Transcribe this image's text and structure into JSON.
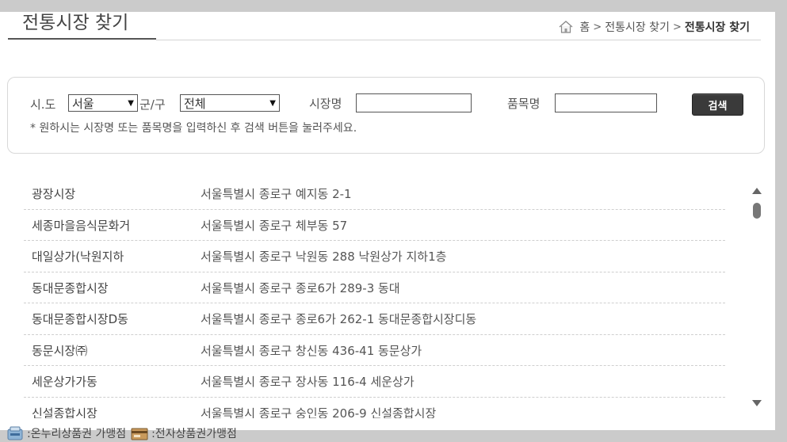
{
  "header": {
    "title": "전통시장 찾기",
    "breadcrumb": {
      "home": "홈",
      "sep": ">",
      "level1": "전통시장 찾기",
      "current": "전통시장 찾기"
    }
  },
  "search": {
    "sido_label": "시.도",
    "sido_value": "서울",
    "gungu_label": "군/구",
    "gungu_value": "전체",
    "market_label": "시장명",
    "market_value": "",
    "item_label": "품목명",
    "item_value": "",
    "button_label": "검색",
    "hint": "* 원하시는 시장명 또는 품목명을 입력하신 후 검색 버튼을 눌러주세요."
  },
  "markets": [
    {
      "name": "광장시장",
      "address": "서울특별시 종로구 예지동 2-1"
    },
    {
      "name": "세종마을음식문화거",
      "address": "서울특별시 종로구 체부동 57"
    },
    {
      "name": "대일상가(낙원지하",
      "address": "서울특별시 종로구 낙원동 288 낙원상가 지하1층"
    },
    {
      "name": "동대문종합시장",
      "address": "서울특별시 종로구 종로6가 289-3 동대"
    },
    {
      "name": "동대문종합시장D동",
      "address": "서울특별시 종로구 종로6가 262-1 동대문종합시장디동"
    },
    {
      "name": "동문시장㈜",
      "address": "서울특별시 종로구 창신동 436-41 동문상가"
    },
    {
      "name": "세운상가가동",
      "address": "서울특별시 종로구 장사동 116-4 세운상가"
    },
    {
      "name": "신설종합시장",
      "address": "서울특별시 종로구 숭인동 206-9 신설종합시장"
    }
  ],
  "legend": {
    "onnuri": ":온누리상품권 가맹점",
    "electronic": ":전자상품권가맹점"
  },
  "icons": [
    "home-icon",
    "onnuri-card-icon",
    "electronic-card-icon",
    "scroll-up-icon",
    "scroll-down-icon"
  ]
}
